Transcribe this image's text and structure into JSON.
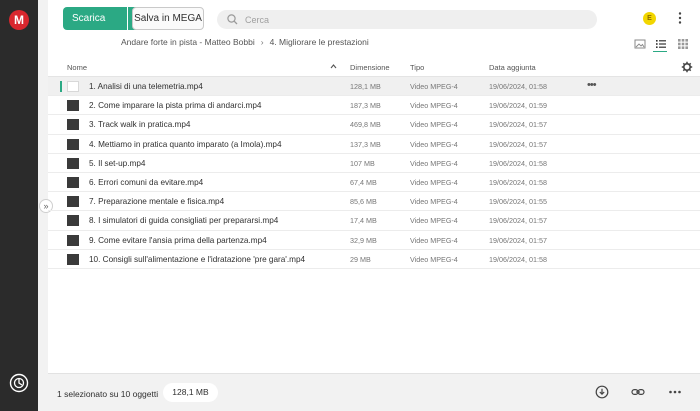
{
  "app": {
    "logo_letter": "M",
    "accent": "#2ba984",
    "brand": "#d9272e"
  },
  "toolbar": {
    "download_label": "Scarica",
    "save_label": "Salva in MEGA",
    "search_placeholder": "Cerca",
    "avatar_letter": "E"
  },
  "breadcrumb": {
    "parent": "Andare forte in pista - Matteo Bobbi",
    "current": "4. Migliorare le prestazioni"
  },
  "table": {
    "headers": {
      "name": "Nome",
      "size": "Dimensione",
      "type": "Tipo",
      "date": "Data aggiunta"
    },
    "rows": [
      {
        "name": "1. Analisi di una telemetria.mp4",
        "size": "128,1 MB",
        "type": "Video MPEG-4",
        "date": "19/06/2024, 01:58",
        "selected": true
      },
      {
        "name": "2. Come imparare la pista prima di andarci.mp4",
        "size": "187,3 MB",
        "type": "Video MPEG-4",
        "date": "19/06/2024, 01:59",
        "selected": false
      },
      {
        "name": "3. Track walk in pratica.mp4",
        "size": "469,8 MB",
        "type": "Video MPEG-4",
        "date": "19/06/2024, 01:57",
        "selected": false
      },
      {
        "name": "4. Mettiamo in pratica quanto imparato (a Imola).mp4",
        "size": "137,3 MB",
        "type": "Video MPEG-4",
        "date": "19/06/2024, 01:57",
        "selected": false
      },
      {
        "name": "5. Il set-up.mp4",
        "size": "107 MB",
        "type": "Video MPEG-4",
        "date": "19/06/2024, 01:58",
        "selected": false
      },
      {
        "name": "6. Errori comuni da evitare.mp4",
        "size": "67,4 MB",
        "type": "Video MPEG-4",
        "date": "19/06/2024, 01:58",
        "selected": false
      },
      {
        "name": "7. Preparazione mentale e fisica.mp4",
        "size": "85,6 MB",
        "type": "Video MPEG-4",
        "date": "19/06/2024, 01:55",
        "selected": false
      },
      {
        "name": "8. I simulatori di guida consigliati per prepararsi.mp4",
        "size": "17,4 MB",
        "type": "Video MPEG-4",
        "date": "19/06/2024, 01:57",
        "selected": false
      },
      {
        "name": "9. Come evitare l'ansia prima della partenza.mp4",
        "size": "32,9 MB",
        "type": "Video MPEG-4",
        "date": "19/06/2024, 01:57",
        "selected": false
      },
      {
        "name": "10. Consigli sull'alimentazione e l'idratazione 'pre gara'.mp4",
        "size": "29 MB",
        "type": "Video MPEG-4",
        "date": "19/06/2024, 01:58",
        "selected": false
      }
    ]
  },
  "footer": {
    "selection_text": "1 selezionato su 10 oggetti",
    "selection_size": "128,1 MB"
  }
}
